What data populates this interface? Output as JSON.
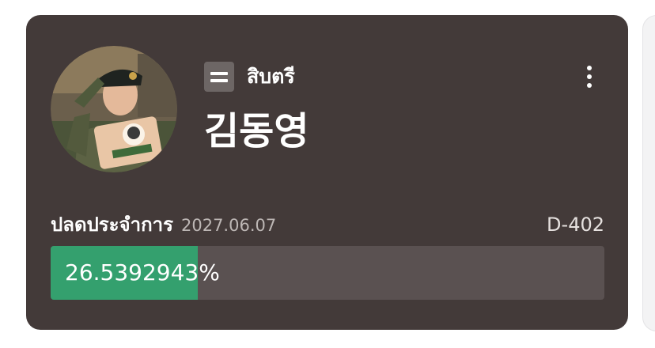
{
  "card": {
    "rank_icon": "sergeant-rank-icon",
    "rank_label": "สิบตรี",
    "name": "김동영",
    "more_icon": "vertical-dots-icon"
  },
  "service": {
    "discharge_label": "ปลดประจำการ",
    "discharge_date": "2027.06.07",
    "dday": "D-402",
    "progress_text": "26.5392943%",
    "progress_fraction": 0.265392943
  },
  "colors": {
    "card_background": "#433a39",
    "progress_fill": "#34a06e",
    "progress_track": "#5a5151",
    "rank_icon_bg": "#6d6665"
  }
}
